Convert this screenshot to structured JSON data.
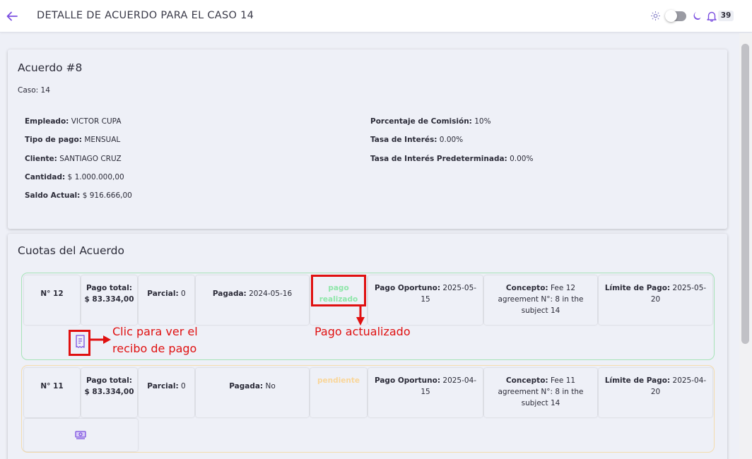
{
  "header": {
    "title": "DETALLE DE ACUERDO PARA EL CASO 14",
    "notifications_count": "39"
  },
  "agreement": {
    "title": "Acuerdo #8",
    "case_line": "Caso: 14",
    "left_fields": [
      {
        "label": "Empleado:",
        "value": "VICTOR CUPA"
      },
      {
        "label": "Tipo de pago:",
        "value": "MENSUAL"
      },
      {
        "label": "Cliente:",
        "value": "SANTIAGO CRUZ"
      },
      {
        "label": "Cantidad:",
        "value": "$ 1.000.000,00"
      },
      {
        "label": "Saldo Actual:",
        "value": "$ 916.666,00"
      }
    ],
    "right_fields": [
      {
        "label": "Porcentaje de Comisión:",
        "value": "10%"
      },
      {
        "label": "Tasa de Interés:",
        "value": "0.00%"
      },
      {
        "label": "Tasa de Interés Predeterminada:",
        "value": "0.00%"
      }
    ]
  },
  "quotas_section": {
    "title": "Cuotas del Acuerdo",
    "quotas": [
      {
        "number": "N° 12",
        "total_label": "Pago total:",
        "total_value": "$ 83.334,00",
        "partial_label": "Parcial:",
        "partial_value": "0",
        "paid_label": "Pagada:",
        "paid_value": "2024-05-16",
        "status_line1": "pago",
        "status_line2": "realizado",
        "opportune_label": "Pago Oportuno:",
        "opportune_value": "2025-05-",
        "opportune_value2": "15",
        "concept_label": "Concepto:",
        "concept_line1": "Fee 12",
        "concept_line2": "agreement N°: 8 in the",
        "concept_line3": "subject 14",
        "limit_label": "Límite de Pago:",
        "limit_value": "2025-05-",
        "limit_value2": "20",
        "action_icon": "receipt-icon"
      },
      {
        "number": "N° 11",
        "total_label": "Pago total:",
        "total_value": "$ 83.334,00",
        "partial_label": "Parcial:",
        "partial_value": "0",
        "paid_label": "Pagada:",
        "paid_value": "No",
        "status_line1": "pendiente",
        "opportune_label": "Pago Oportuno:",
        "opportune_value": "2025-04-",
        "opportune_value2": "15",
        "concept_label": "Concepto:",
        "concept_line1": "Fee 11",
        "concept_line2": "agreement N°: 8 in the",
        "concept_line3": "subject 14",
        "limit_label": "Límite de Pago:",
        "limit_value": "2025-04-",
        "limit_value2": "20",
        "action_icon": "pay-money-icon"
      }
    ]
  },
  "annotations": {
    "receipt_note_line1": "Clic para ver el",
    "receipt_note_line2": "recibo de pago",
    "status_note": "Pago actualizado"
  },
  "colors": {
    "accent": "#7b4fe0",
    "annotation": "#e01010",
    "paid_border": "#a6e3b8",
    "paid_text": "#8ee6a9",
    "pending_border": "#f4dcae",
    "pending_text": "#f9d69a"
  }
}
